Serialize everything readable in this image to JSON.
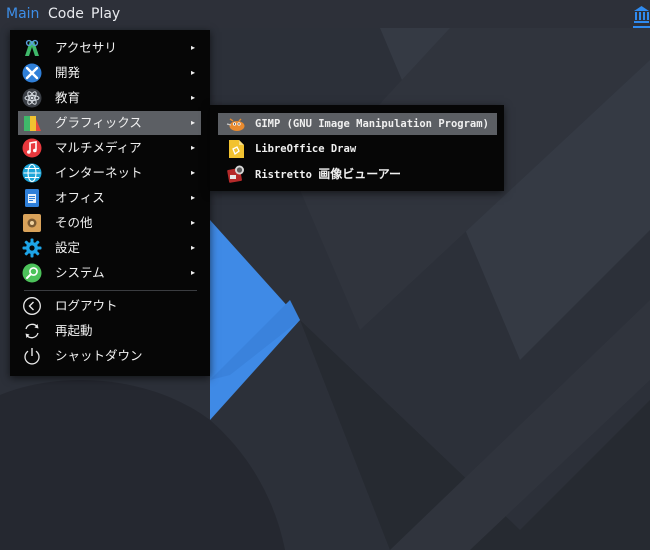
{
  "panel": {
    "menus": [
      "Main",
      "Code",
      "Play"
    ],
    "right_icon": "bank-icon",
    "accent_color": "#3d8ee8"
  },
  "main_menu": {
    "items": [
      {
        "label": "アクセサリ",
        "icon": "accessories-icon",
        "submenu": true
      },
      {
        "label": "開発",
        "icon": "development-icon",
        "submenu": true
      },
      {
        "label": "教育",
        "icon": "education-atom-icon",
        "submenu": true
      },
      {
        "label": "グラフィックス",
        "icon": "graphics-icon",
        "submenu": true,
        "highlighted": true
      },
      {
        "label": "マルチメディア",
        "icon": "multimedia-note-icon",
        "submenu": true
      },
      {
        "label": "インターネット",
        "icon": "internet-globe-icon",
        "submenu": true
      },
      {
        "label": "オフィス",
        "icon": "office-icon",
        "submenu": true
      },
      {
        "label": "その他",
        "icon": "other-icon",
        "submenu": true
      },
      {
        "label": "設定",
        "icon": "settings-gear-icon",
        "submenu": true
      },
      {
        "label": "システム",
        "icon": "system-search-icon",
        "submenu": true
      }
    ],
    "session": [
      {
        "label": "ログアウト",
        "icon": "logout-icon"
      },
      {
        "label": "再起動",
        "icon": "restart-icon"
      },
      {
        "label": "シャットダウン",
        "icon": "shutdown-icon"
      }
    ],
    "arrow": "▸"
  },
  "sub_menu": {
    "items": [
      {
        "label": "GIMP (GNU Image Manipulation Program)",
        "icon": "gimp-icon",
        "highlighted": true
      },
      {
        "label": "LibreOffice Draw",
        "icon": "libreoffice-draw-icon"
      },
      {
        "label_latin": "Ristretto ",
        "label_ja": "画像ビューアー",
        "icon": "ristretto-icon"
      }
    ]
  }
}
